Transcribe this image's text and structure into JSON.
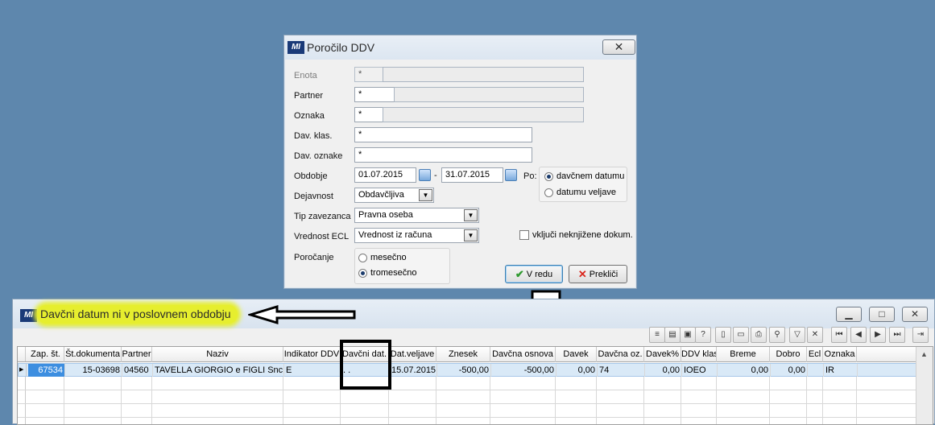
{
  "dialog": {
    "title": "Poročilo DDV",
    "close_icon": "close-icon",
    "fields": {
      "enota": {
        "label": "Enota",
        "value": "*"
      },
      "partner": {
        "label": "Partner",
        "value": "*"
      },
      "oznaka": {
        "label": "Oznaka",
        "value": "*"
      },
      "dav_klas": {
        "label": "Dav. klas.",
        "value": "*"
      },
      "dav_oznake": {
        "label": "Dav. oznake",
        "value": "*"
      },
      "obdobje": {
        "label": "Obdobje",
        "from": "01.07.2015",
        "sep": "-",
        "to": "31.07.2015"
      },
      "dejavnost": {
        "label": "Dejavnost",
        "value": "Obdavčljiva"
      },
      "tip_zavezanca": {
        "label": "Tip zavezanca",
        "value": "Pravna oseba"
      },
      "vrednost_ecl": {
        "label": "Vrednost ECL",
        "value": "Vrednost iz računa"
      },
      "porocanje": {
        "label": "Poročanje",
        "options": [
          "mesečno",
          "tromesečno"
        ],
        "selected": "tromesečno"
      }
    },
    "po": {
      "label": "Po:",
      "options": [
        "davčnem datumu",
        "datumu veljave"
      ],
      "selected": "davčnem datumu"
    },
    "vkljuci_label": "vključi neknjižene dokum.",
    "ok_label": "V redu",
    "cancel_label": "Prekliči"
  },
  "window": {
    "message": "Davčni datum ni v poslovnem obdobju",
    "columns": [
      "Zap. št.",
      "Št.dokumenta",
      "Partner",
      "Naziv",
      "Indikator DDV",
      "Davčni dat.",
      "Dat.veljave",
      "Znesek",
      "Davčna osnova",
      "Davek",
      "Davčna oz.",
      "Davek%",
      "DDV klas",
      "Breme",
      "Dobro",
      "Ecl",
      "Oznaka"
    ],
    "rows": [
      [
        "67534",
        "15-03698",
        "04560",
        "TAVELLA GIORGIO e FIGLI Snc",
        "E",
        " .  .",
        "15.07.2015",
        "-500,00",
        "-500,00",
        "0,00",
        "74",
        "0,00",
        "IOEO",
        "0,00",
        "0,00",
        "",
        "IR"
      ]
    ]
  },
  "colors": {
    "desktop": "#5e87ad",
    "highlight": "#e6ee2e",
    "selected_cell": "#3d8ee0"
  }
}
